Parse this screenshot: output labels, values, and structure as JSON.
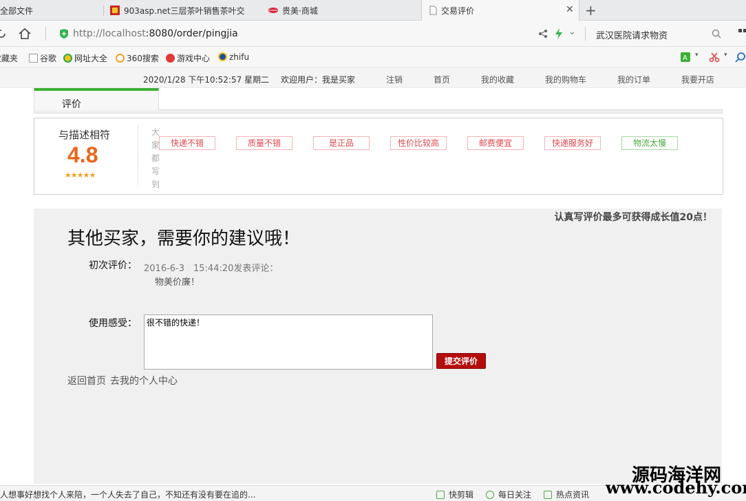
{
  "tabs": [
    {
      "label": "全部文件"
    },
    {
      "label": "903asp.net三层茶叶销售茶叶交"
    },
    {
      "label": "贵美·商城"
    },
    {
      "label": "交易评价"
    }
  ],
  "address": {
    "url_host": "http://localhost",
    "url_rest": ":8080/order/pingjia",
    "search_text": "武汉医院请求物资"
  },
  "bookmarks": [
    {
      "label": "收藏夹"
    },
    {
      "label": "谷歌"
    },
    {
      "label": "网址大全"
    },
    {
      "label": "360搜索"
    },
    {
      "label": "游戏中心"
    },
    {
      "label": "zhifu"
    }
  ],
  "sitenav": {
    "datetime": "2020/1/28 下午10:52:57 星期二",
    "welcome": "欢迎用户：我是买家",
    "items": [
      {
        "label": "注销"
      },
      {
        "label": "首页"
      },
      {
        "label": "我的收藏"
      },
      {
        "label": "我的购物车"
      },
      {
        "label": "我的订单"
      },
      {
        "label": "我要开店"
      }
    ]
  },
  "review": {
    "tab_label": "评价",
    "score_label": "与描述相符",
    "score": "4.8",
    "stars": "★★★★★",
    "side_text": "大家都写到",
    "tags": [
      {
        "label": "快递不错"
      },
      {
        "label": "质量不错"
      },
      {
        "label": "是正品"
      },
      {
        "label": "性价比较高"
      },
      {
        "label": "邮费便宜"
      },
      {
        "label": "快递服务好"
      },
      {
        "label": "物流太慢"
      }
    ]
  },
  "main": {
    "note": "认真写评价最多可获得成长值20点！",
    "heading": "其他买家，需要你的建议哦！",
    "first_label": "初次评价：",
    "first_date": "2016-6-3　15:44:20发表评论：",
    "first_text": "物美价廉！",
    "usage_label": "使用感受：",
    "usage_value": "很不错的快递！",
    "submit_label": "提交评价",
    "link_home": "返回首页",
    "link_center": "去我的个人中心"
  },
  "statusbar": {
    "left_text": "人想事好想找个人来陪，一个人失去了自己，不知还有没有要在追的...",
    "items": [
      {
        "label": "快剪辑"
      },
      {
        "label": "每日关注"
      },
      {
        "label": "热点资讯"
      }
    ]
  },
  "watermark": {
    "line1": "源码海洋网",
    "line2": "www.codehy.com"
  },
  "colors": {
    "accent_green": "#3cb034",
    "score_orange": "#e8661a",
    "submit_red": "#b50d0d",
    "tag_red": "#e0464e",
    "tag_green": "#4aa93e"
  }
}
